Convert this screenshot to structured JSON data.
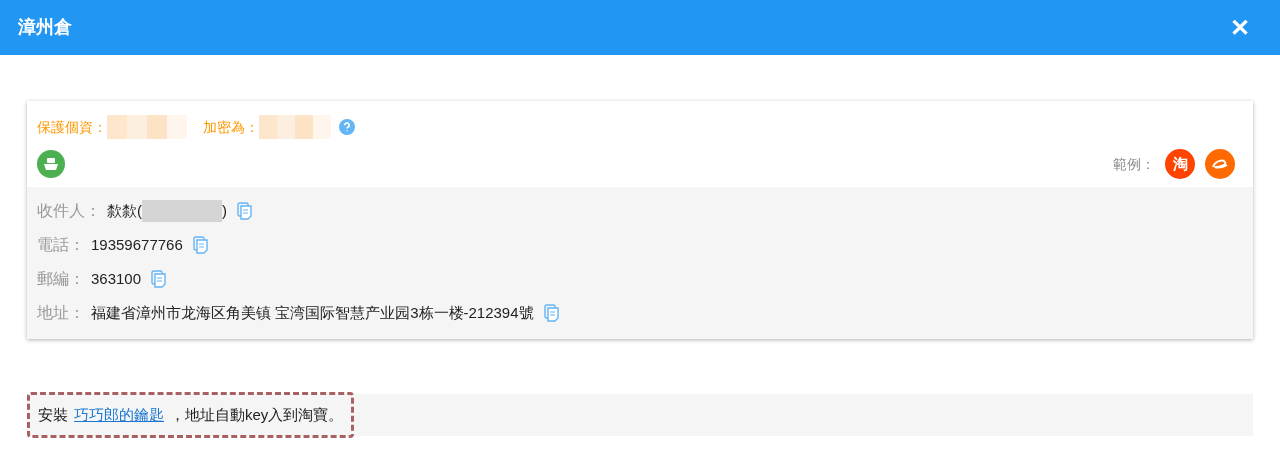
{
  "window": {
    "title": "漳州倉",
    "close": "✕"
  },
  "privacy": {
    "label": "保護個資：",
    "encrypt_label": "加密為："
  },
  "sample": {
    "label": "範例：",
    "taobao_glyph": "淘"
  },
  "fields": [
    {
      "label": "收件人：",
      "prefix": "歀歀(",
      "suffix": ")",
      "redacted": true
    },
    {
      "label": "電話：",
      "prefix": "19359677766",
      "redacted": false
    },
    {
      "label": "郵編：",
      "prefix": "363100",
      "redacted": false
    },
    {
      "label": "地址：",
      "prefix": "福建省漳州市龙海区角美镇 宝湾国际智慧产业园3栋一楼-212394號",
      "redacted": false
    }
  ],
  "notice": {
    "before": "安裝",
    "link": "巧巧郎的鑰匙",
    "after": "，地址自動key入到淘寶。"
  }
}
